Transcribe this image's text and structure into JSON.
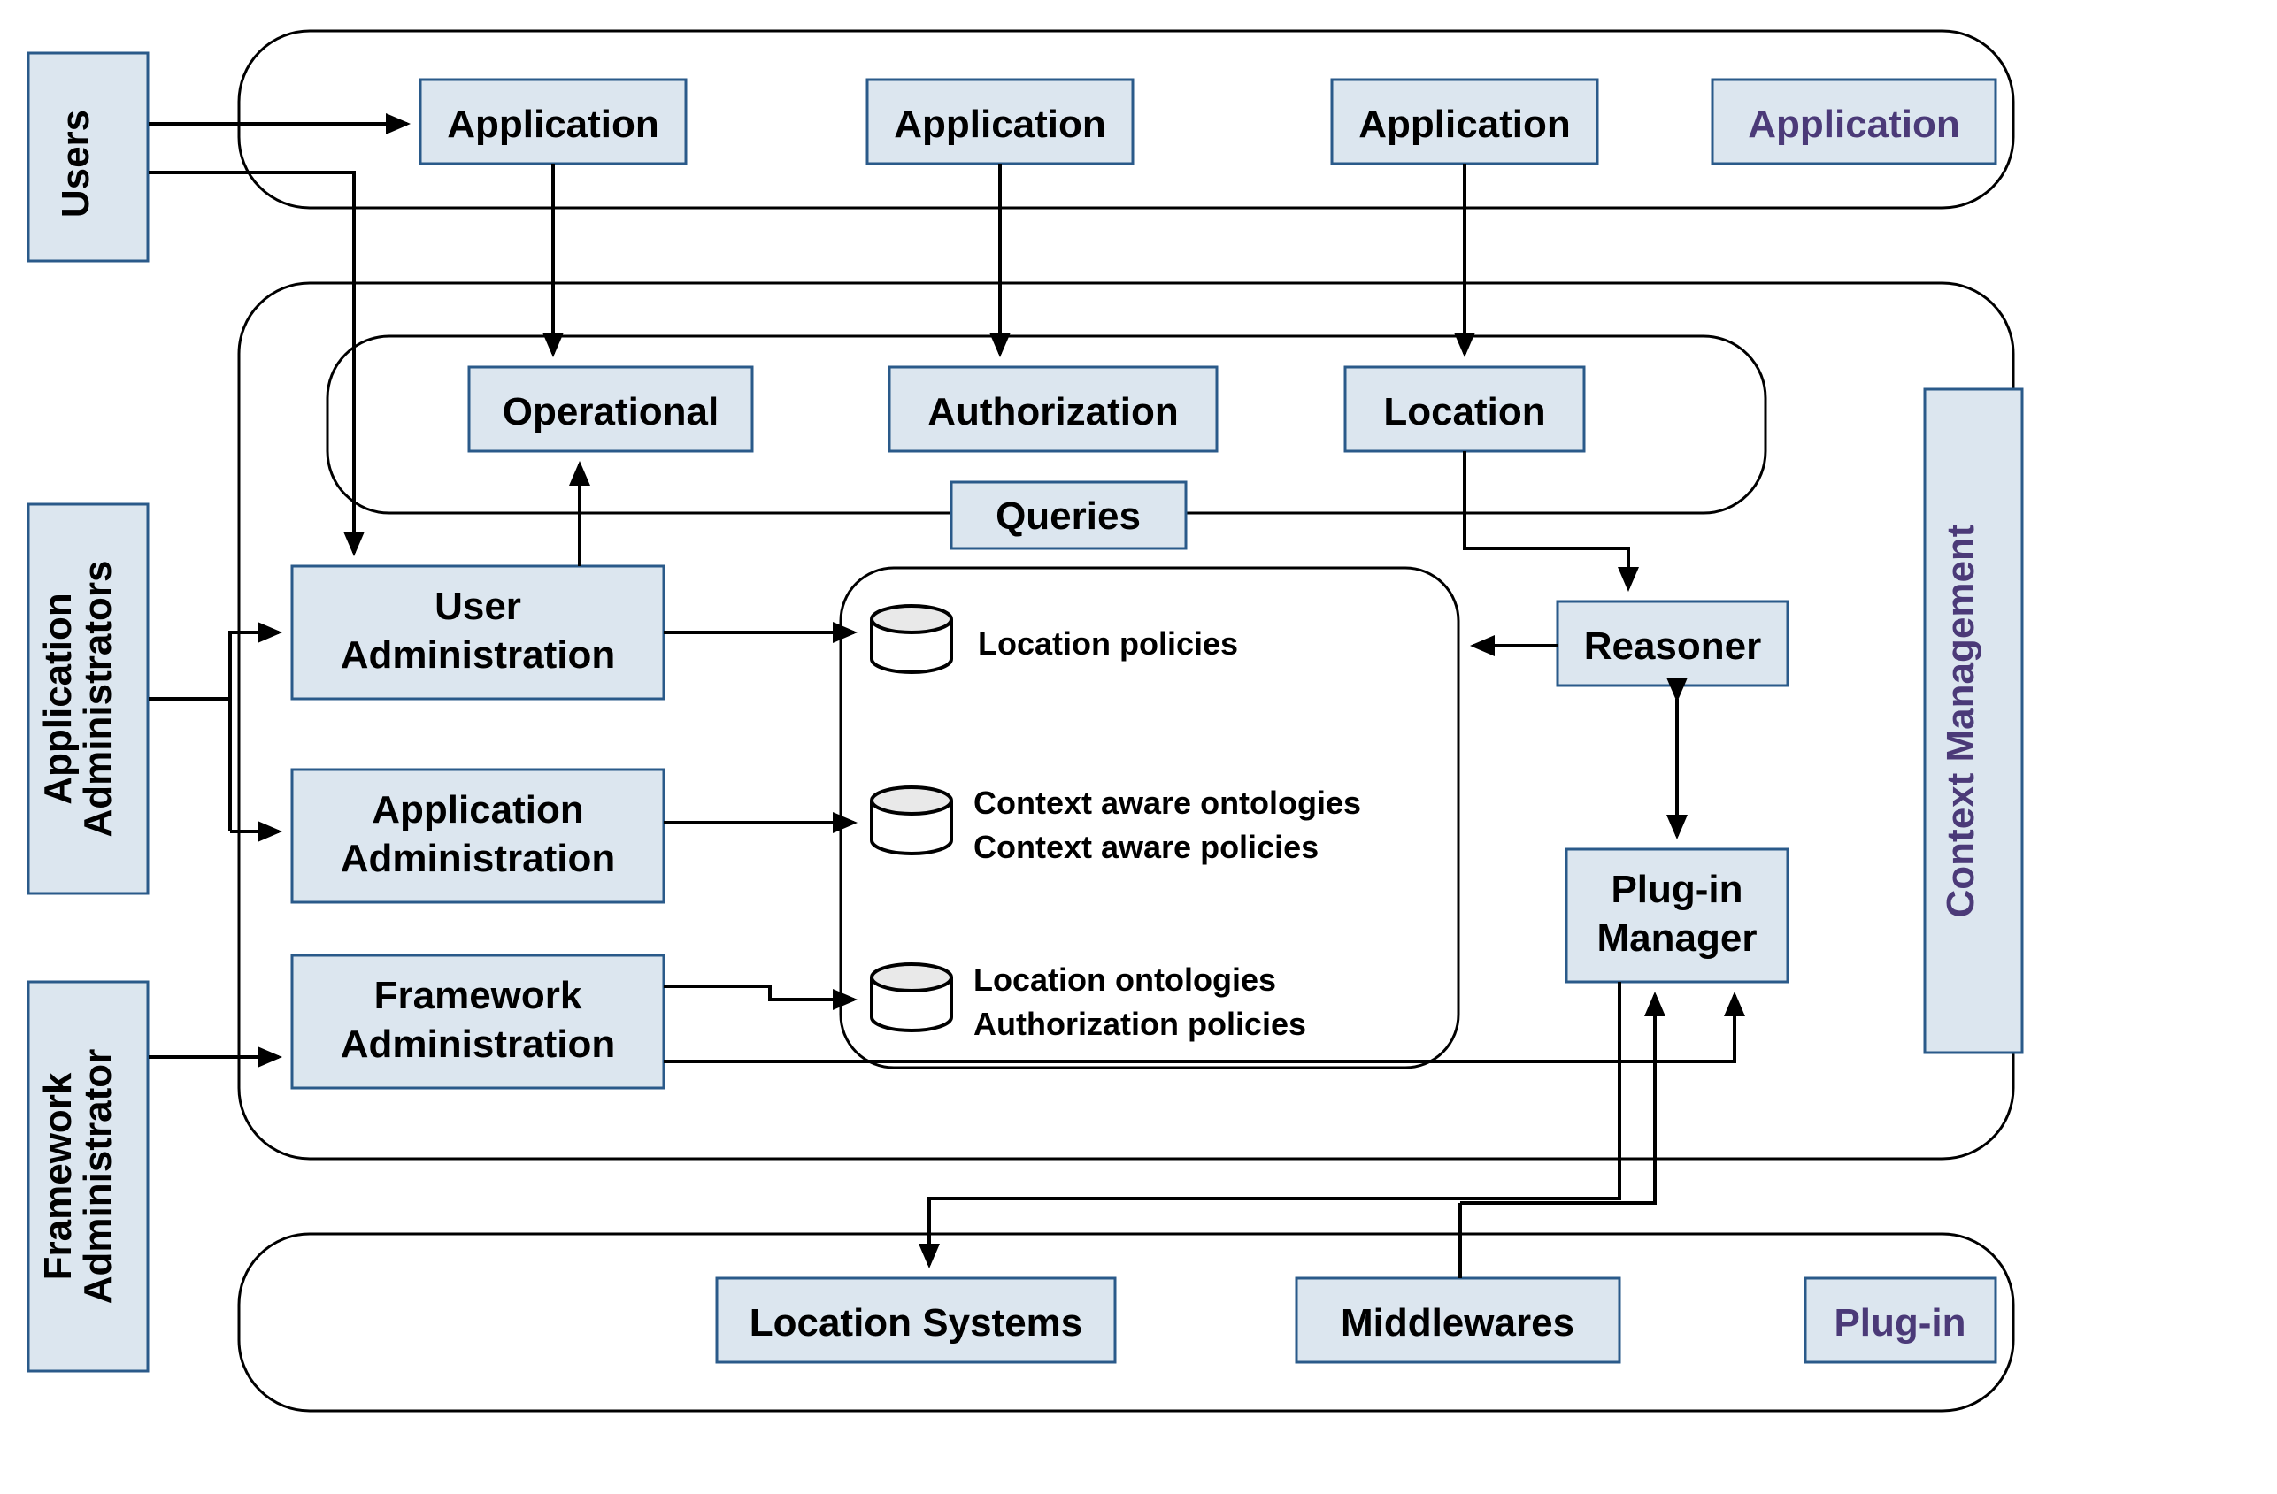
{
  "roles": {
    "users": "Users",
    "app_admins_l1": "Application",
    "app_admins_l2": "Administrators",
    "fw_admin_l1": "Framework",
    "fw_admin_l2": "Administrator"
  },
  "layers": {
    "application": "Application",
    "context_mgmt": "Context Management",
    "plugin": "Plug-in"
  },
  "apps": {
    "a1": "Application",
    "a2": "Application",
    "a3": "Application"
  },
  "queries": {
    "operational": "Operational",
    "authorization": "Authorization",
    "location": "Location",
    "label": "Queries"
  },
  "admin": {
    "user_l1": "User",
    "user_l2": "Administration",
    "app_l1": "Application",
    "app_l2": "Administration",
    "fw_l1": "Framework",
    "fw_l2": "Administration"
  },
  "db": {
    "loc_policies": "Location policies",
    "ca_ontologies": "Context aware ontologies",
    "ca_policies": "Context aware policies",
    "loc_ontologies": "Location ontologies",
    "auth_policies": "Authorization policies"
  },
  "right": {
    "reasoner": "Reasoner",
    "plugin_mgr_l1": "Plug-in",
    "plugin_mgr_l2": "Manager"
  },
  "plugins": {
    "loc_systems": "Location Systems",
    "middlewares": "Middlewares"
  }
}
